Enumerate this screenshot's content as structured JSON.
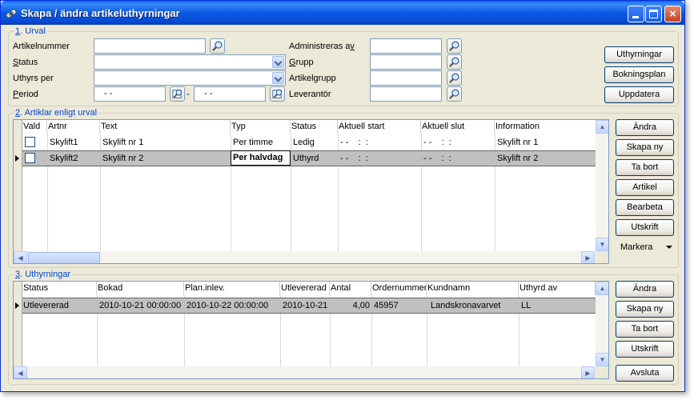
{
  "window": {
    "title": "Skapa / ändra artikeluthyrningar",
    "minimize_glyph": "_",
    "close_glyph": "×"
  },
  "urval": {
    "legend_num": "1",
    "legend_text": ". Urval",
    "artikelnummer_label": "Artikelnummer",
    "artikelnummer_value": "",
    "status_label": "Status",
    "status_value": "",
    "uthyrs_per_label": "Uthyrs per",
    "uthyrs_per_value": "",
    "period_label": "Period",
    "period_from": "   - -",
    "period_to": "   - -",
    "period_dash": "-",
    "administreras_label": "Administreras av",
    "administreras_value": "",
    "grupp_label": "Grupp",
    "grupp_value": "",
    "artikelgrupp_label": "Artikelgrupp",
    "artikelgrupp_value": "",
    "leverantor_label": "Leverantör",
    "leverantor_value": "",
    "btn_uthyrningar": "Uthyrningar",
    "btn_bokningsplan": "Bokningsplan",
    "btn_uppdatera": "Uppdatera"
  },
  "artiklar": {
    "legend_num": "2",
    "legend_text": ". Artiklar enligt urval",
    "columns": [
      "Vald",
      "Artnr",
      "Text",
      "Typ",
      "Status",
      "Aktuell start",
      "Aktuell slut",
      "Information"
    ],
    "rows": [
      {
        "vald": false,
        "artnr": "Skylift1",
        "text": "Skylift nr 1",
        "typ": "Per timme",
        "status": "Ledig",
        "start": "- -    :  :",
        "slut": "- -    :  :",
        "info": "Skylift nr 1"
      },
      {
        "vald": false,
        "artnr": "Skylift2",
        "text": "Skylift nr 2",
        "typ": "Per halvdag",
        "status": "Uthyrd",
        "start": "- -    :  :",
        "slut": "- -    :  :",
        "info": "Skylift nr 2"
      }
    ],
    "btn_andra": "Ändra",
    "btn_skapa_ny": "Skapa ny",
    "btn_ta_bort": "Ta bort",
    "btn_artikel": "Artikel",
    "btn_bearbeta": "Bearbeta",
    "btn_utskrift": "Utskrift",
    "btn_markera": "Markera"
  },
  "uthyrningar": {
    "legend_num": "3",
    "legend_text": ". Uthyrningar",
    "columns": [
      "Status",
      "Bokad",
      "Plan.inlev.",
      "Utlevererad",
      "Antal",
      "Ordernummer",
      "Kundnamn",
      "Uthyrd av"
    ],
    "rows": [
      {
        "status": "Utlevererad",
        "bokad": "2010-10-21 00:00:00",
        "plan": "2010-10-22 00:00:00",
        "utlevererad": "2010-10-21",
        "antal": "4,00",
        "order": "45957",
        "kund": "Landskronavarvet",
        "uthyrd_av": "LL"
      }
    ],
    "btn_andra": "Ändra",
    "btn_skapa_ny": "Skapa ny",
    "btn_ta_bort": "Ta bort",
    "btn_utskrift": "Utskrift",
    "btn_avsluta": "Avsluta"
  },
  "icons": {
    "lookup": "magnifier-icon",
    "dropdown": "chevron-down-icon"
  },
  "colors": {
    "title_bar": "#0b5ae6",
    "legend_text": "#0046d5",
    "selected_row": "#c0c0c0",
    "window_bg": "#ece9d8"
  }
}
